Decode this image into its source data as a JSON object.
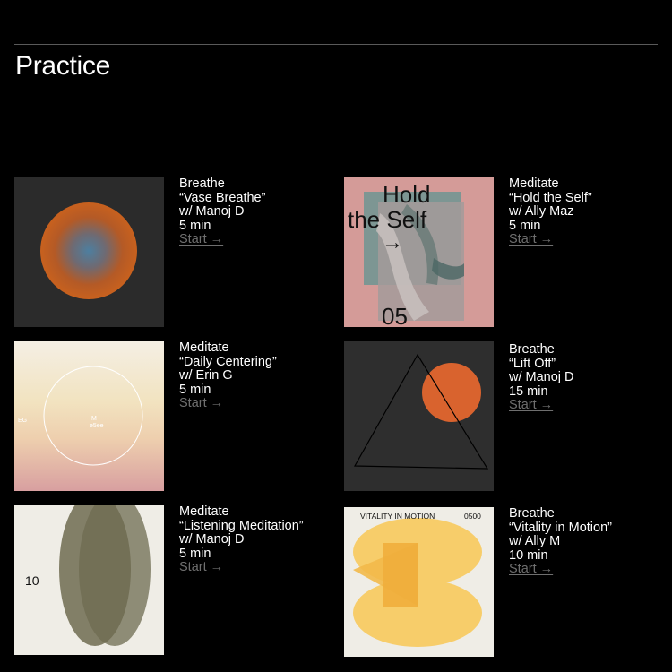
{
  "page": {
    "title": "Practice"
  },
  "cards": [
    {
      "type": "Breathe",
      "title": "“Vase Breathe”",
      "instructor": "w/ Manoj D",
      "duration": "5 min",
      "cta": "Start →",
      "art": "orange-blue-gradient-circle"
    },
    {
      "type": "Meditate",
      "title": "“Hold the Self”",
      "instructor": "w/ Ally Maz",
      "duration": "5 min",
      "cta": "Start →",
      "art": "pink-photo-collage",
      "art_text": {
        "line1": "Hold",
        "line2": "the Self",
        "arrow": "→",
        "number": "05"
      }
    },
    {
      "type": "Meditate",
      "title": "“Daily Centering”",
      "instructor": "w/ Erin G",
      "duration": "5 min",
      "cta": "Start →",
      "art": "cream-pink-gradient-ring",
      "art_text": {
        "left": "EG",
        "center_top": "M",
        "center_bottom": "e5ee"
      }
    },
    {
      "type": "Breathe",
      "title": "“Lift Off”",
      "instructor": "w/ Manoj D",
      "duration": "15 min",
      "cta": "Start →",
      "art": "triangle-with-orange-circle"
    },
    {
      "type": "Meditate",
      "title": "“Listening Meditation”",
      "instructor": "w/ Manoj D",
      "duration": "5 min",
      "cta": "Start →",
      "art": "overlapping-olive-ellipses",
      "art_text": {
        "number": "10"
      }
    },
    {
      "type": "Breathe",
      "title": "“Vitality in Motion”",
      "instructor": "w/ Ally M",
      "duration": "10 min",
      "cta": "Start →",
      "art": "yellow-overlapping-shapes",
      "art_text": {
        "left": "VITALITY IN MOTION",
        "right": "0500"
      }
    }
  ],
  "colors": {
    "background": "#000000",
    "text": "#ffffff",
    "link_muted": "#6f6f6f",
    "orange": "#d9632e",
    "olive": "#6e6b50",
    "yellow": "#f7cd6a",
    "pink": "#d49b98"
  }
}
